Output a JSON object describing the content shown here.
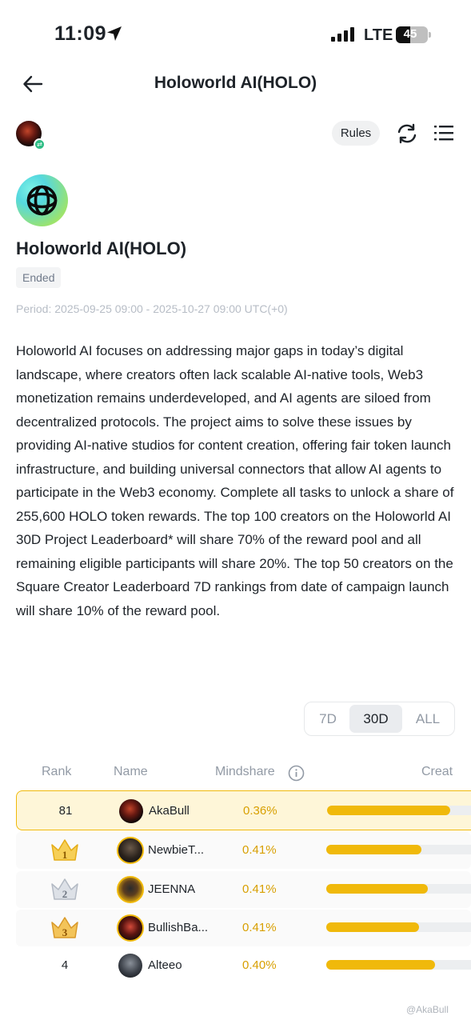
{
  "status": {
    "time": "11:09",
    "network": "LTE",
    "battery": "45"
  },
  "nav": {
    "title": "Holoworld AI(HOLO)"
  },
  "toolbar": {
    "rules_label": "Rules"
  },
  "project": {
    "title": "Holoworld AI(HOLO)",
    "status_badge": "Ended",
    "period": "Period: 2025-09-25 09:00 - 2025-10-27 09:00 UTC(+0)",
    "description": "Holoworld AI focuses on addressing major gaps in today’s digital landscape, where creators often lack scalable AI-native tools, Web3 monetization remains underdeveloped, and AI agents are siloed from decentralized protocols. The project aims to solve these issues by providing AI-native studios for content creation, offering fair token launch infrastructure, and building universal connectors that allow AI agents to participate in the Web3 economy. Complete all tasks to unlock a share of 255,600 HOLO token rewards. The top 100 creators on the Holoworld AI 30D Project Leaderboard* will share 70% of the reward pool and all remaining eligible participants will share 20%. The top 50 creators on the Square Creator Leaderboard 7D rankings from date of campaign launch will share 10% of the reward pool."
  },
  "tabs": {
    "items": [
      "7D",
      "30D",
      "ALL"
    ],
    "selected": "30D"
  },
  "leaderboard": {
    "headers": {
      "rank": "Rank",
      "name": "Name",
      "mindshare": "Mindshare",
      "creator": "Creat"
    },
    "rows": [
      {
        "rank": "81",
        "name": "AkaBull",
        "mindshare": "0.36%",
        "bar_fill": 0.85,
        "highlight": true
      },
      {
        "rank": "1",
        "name": "NewbieT...",
        "mindshare": "0.41%",
        "bar_fill": 0.66,
        "crown": "gold"
      },
      {
        "rank": "2",
        "name": "JEENNA",
        "mindshare": "0.41%",
        "bar_fill": 0.7,
        "crown": "silver"
      },
      {
        "rank": "3",
        "name": "BullishBa...",
        "mindshare": "0.41%",
        "bar_fill": 0.64,
        "crown": "bronze"
      },
      {
        "rank": "4",
        "name": "Alteeo",
        "mindshare": "0.40%",
        "bar_fill": 0.75
      }
    ]
  },
  "watermark": "@AkaBull",
  "colors": {
    "accent": "#f0b90b",
    "mindshare_text": "#d89f00",
    "highlight_bg": "#fef6d8"
  }
}
